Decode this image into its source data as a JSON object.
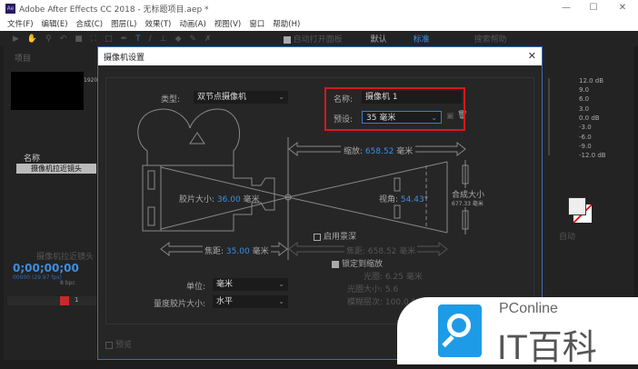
{
  "window": {
    "logo": "Ae",
    "title": "Adobe After Effects CC 2018 - 无标题项目.aep *",
    "min": "—",
    "max": "☐",
    "close": "✕"
  },
  "menu": [
    "文件(F)",
    "编辑(E)",
    "合成(C)",
    "图层(L)",
    "效果(T)",
    "动画(A)",
    "视图(V)",
    "窗口",
    "帮助(H)"
  ],
  "toolbar": {
    "auto_open": "自动打开面板",
    "workspace_default": "默认",
    "workspace_standard": "标准",
    "search_help": "搜索帮助"
  },
  "project": {
    "tab": "项目",
    "name_header": "名称",
    "item": "摄像机拉近镜头",
    "bpc": "8 bpc",
    "info": "1920"
  },
  "timeline": {
    "comp_tab": "摄像机拉近镜头",
    "timecode": "0;00;00;00",
    "fps": "00000 (29.97 fps)",
    "layer_index": "1"
  },
  "audio": {
    "levels": [
      "12.0 dB",
      "9.0",
      "6.0",
      "3.0",
      "0.0 dB",
      "-3.0",
      "-6.0",
      "-9.0",
      "-12.0 dB"
    ]
  },
  "paint": {
    "auto": "自动"
  },
  "dialog": {
    "title": "摄像机设置",
    "close": "✕",
    "type_label": "类型:",
    "type_value": "双节点摄像机",
    "name_label": "名称:",
    "name_value": "摄像机 1",
    "preset_label": "预设:",
    "preset_value": "35 毫米",
    "zoom_label": "缩放:",
    "zoom_value": "658.52",
    "zoom_unit": "毫米",
    "film_label": "胶片大小:",
    "film_value": "36.00",
    "film_unit": "毫米",
    "angle_label": "视角:",
    "angle_value": "54.43",
    "angle_unit": "°",
    "comp_label": "合成大小",
    "comp_value": "677.33 毫米",
    "dof_label": "启用景深",
    "focal_label": "焦距:",
    "focal_value": "35.00",
    "focal_unit": "毫米",
    "focus_label": "焦距:",
    "focus_value": "658.52 毫米",
    "lock_label": "锁定到缩放",
    "aperture_label": "光圈:",
    "aperture_value": "6.25 毫米",
    "fstop_label": "光圈大小:",
    "fstop_value": "5.6",
    "blur_label": "模糊层次:",
    "blur_value": "100.0 %",
    "units_label": "单位:",
    "units_value": "毫米",
    "measure_label": "量度胶片大小:",
    "measure_value": "水平",
    "preview_label": "预览"
  },
  "watermark": {
    "brand": "PConline",
    "text": "IT百科"
  }
}
